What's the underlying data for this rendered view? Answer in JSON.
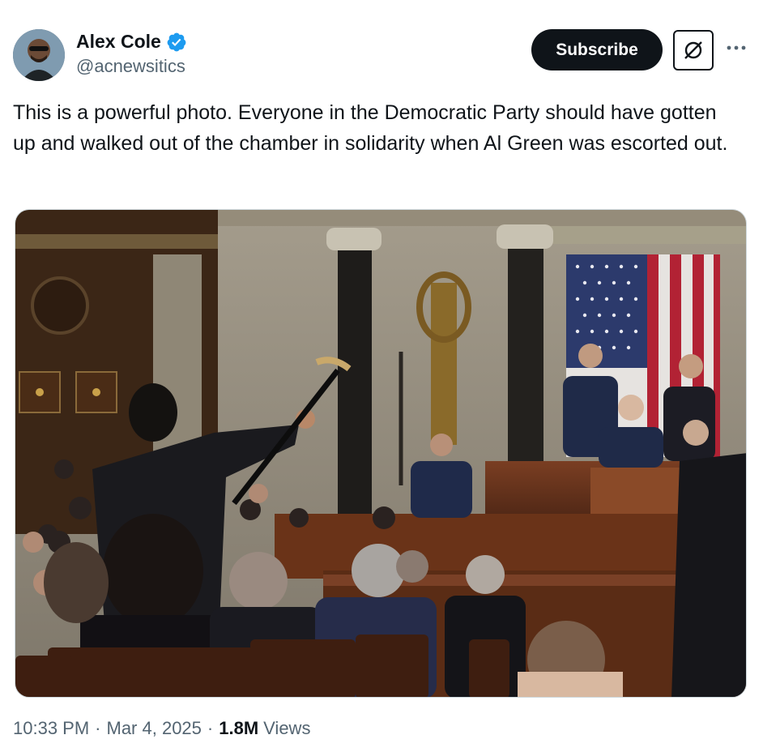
{
  "author": {
    "display_name": "Alex Cole",
    "handle": "@acnewsitics",
    "verified": true,
    "avatar_icon": "profile-photo"
  },
  "actions": {
    "subscribe_label": "Subscribe",
    "grok_icon": "grok-icon",
    "more_icon": "more-options-icon"
  },
  "tweet": {
    "text": "This is a powerful photo. Everyone in the Democratic Party should have gotten up and walked out of the chamber in solidarity when Al Green was escorted out.",
    "image_icon": "photo-house-chamber"
  },
  "meta": {
    "time": "10:33 PM",
    "separator": "·",
    "date": "Mar 4, 2025",
    "views_count": "1.8M",
    "views_label": "Views"
  },
  "colors": {
    "text_primary": "#0f1419",
    "text_secondary": "#536471",
    "verified_blue": "#1d9bf0",
    "button_dark": "#0f1419"
  }
}
